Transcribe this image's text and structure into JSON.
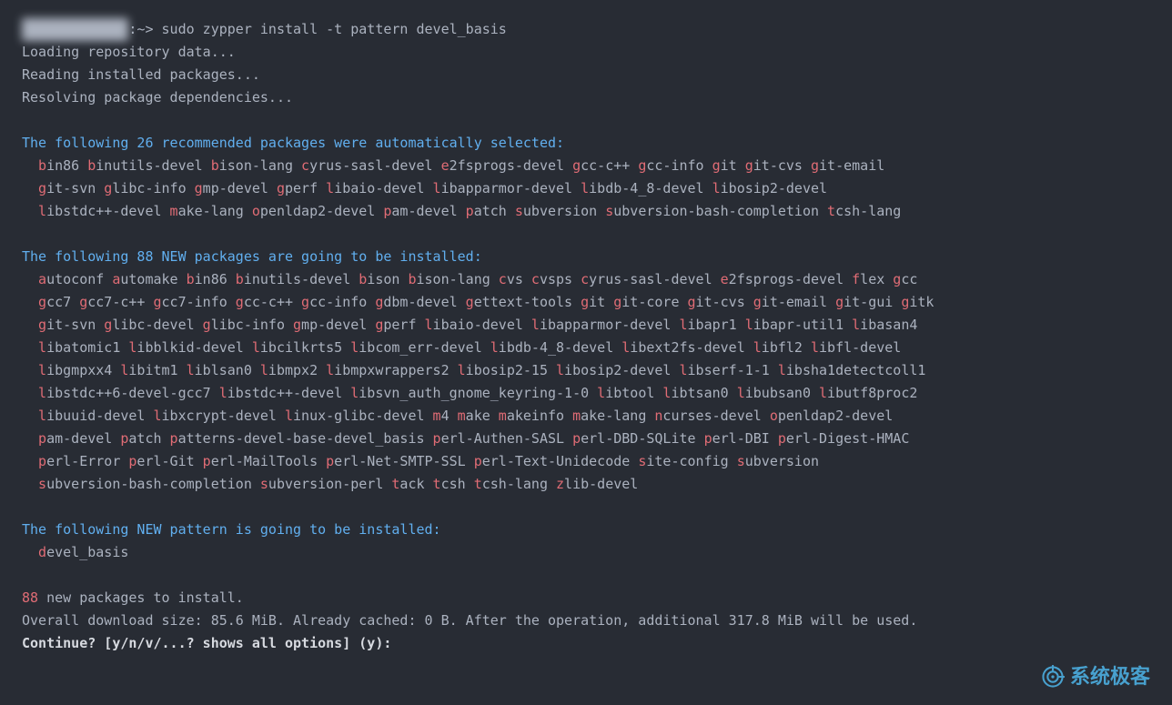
{
  "prompt_host_blurred": "user@hostname",
  "prompt_suffix": ":~> ",
  "command": "sudo zypper install -t pattern devel_basis",
  "loading_lines": [
    "Loading repository data...",
    "Reading installed packages...",
    "Resolving package dependencies..."
  ],
  "recommended": {
    "header": "The following 26 recommended packages were automatically selected:",
    "count": 26,
    "packages": [
      "bin86",
      "binutils-devel",
      "bison-lang",
      "cyrus-sasl-devel",
      "e2fsprogs-devel",
      "gcc-c++",
      "gcc-info",
      "git",
      "git-cvs",
      "git-email",
      "git-svn",
      "glibc-info",
      "gmp-devel",
      "gperf",
      "libaio-devel",
      "libapparmor-devel",
      "libdb-4_8-devel",
      "libosip2-devel",
      "libstdc++-devel",
      "make-lang",
      "openldap2-devel",
      "pam-devel",
      "patch",
      "subversion",
      "subversion-bash-completion",
      "tcsh-lang"
    ],
    "breaks": [
      10,
      18,
      26
    ]
  },
  "new_pkgs": {
    "header": "The following 88 NEW packages are going to be installed:",
    "count": 88,
    "packages": [
      "autoconf",
      "automake",
      "bin86",
      "binutils-devel",
      "bison",
      "bison-lang",
      "cvs",
      "cvsps",
      "cyrus-sasl-devel",
      "e2fsprogs-devel",
      "flex",
      "gcc",
      "gcc7",
      "gcc7-c++",
      "gcc7-info",
      "gcc-c++",
      "gcc-info",
      "gdbm-devel",
      "gettext-tools",
      "git",
      "git-core",
      "git-cvs",
      "git-email",
      "git-gui",
      "gitk",
      "git-svn",
      "glibc-devel",
      "glibc-info",
      "gmp-devel",
      "gperf",
      "libaio-devel",
      "libapparmor-devel",
      "libapr1",
      "libapr-util1",
      "libasan4",
      "libatomic1",
      "libblkid-devel",
      "libcilkrts5",
      "libcom_err-devel",
      "libdb-4_8-devel",
      "libext2fs-devel",
      "libfl2",
      "libfl-devel",
      "libgmpxx4",
      "libitm1",
      "liblsan0",
      "libmpx2",
      "libmpxwrappers2",
      "libosip2-15",
      "libosip2-devel",
      "libserf-1-1",
      "libsha1detectcoll1",
      "libstdc++6-devel-gcc7",
      "libstdc++-devel",
      "libsvn_auth_gnome_keyring-1-0",
      "libtool",
      "libtsan0",
      "libubsan0",
      "libutf8proc2",
      "libuuid-devel",
      "libxcrypt-devel",
      "linux-glibc-devel",
      "m4",
      "make",
      "makeinfo",
      "make-lang",
      "ncurses-devel",
      "openldap2-devel",
      "pam-devel",
      "patch",
      "patterns-devel-base-devel_basis",
      "perl-Authen-SASL",
      "perl-DBD-SQLite",
      "perl-DBI",
      "perl-Digest-HMAC",
      "perl-Error",
      "perl-Git",
      "perl-MailTools",
      "perl-Net-SMTP-SSL",
      "perl-Text-Unidecode",
      "site-config",
      "subversion",
      "subversion-bash-completion",
      "subversion-perl",
      "tack",
      "tcsh",
      "tcsh-lang",
      "zlib-devel"
    ],
    "breaks": [
      12,
      25,
      35,
      43,
      52,
      59,
      68,
      75,
      82,
      88
    ]
  },
  "new_pattern": {
    "header": "The following NEW pattern is going to be installed:",
    "patterns": [
      "devel_basis"
    ]
  },
  "summary": {
    "count": 88,
    "count_suffix": " new packages to install.",
    "overall": "Overall download size: 85.6 MiB. Already cached: 0 B. After the operation, additional 317.8 MiB will be used.",
    "prompt": "Continue? [y/n/v/...? shows all options] (y): "
  },
  "watermark": "系统极客"
}
